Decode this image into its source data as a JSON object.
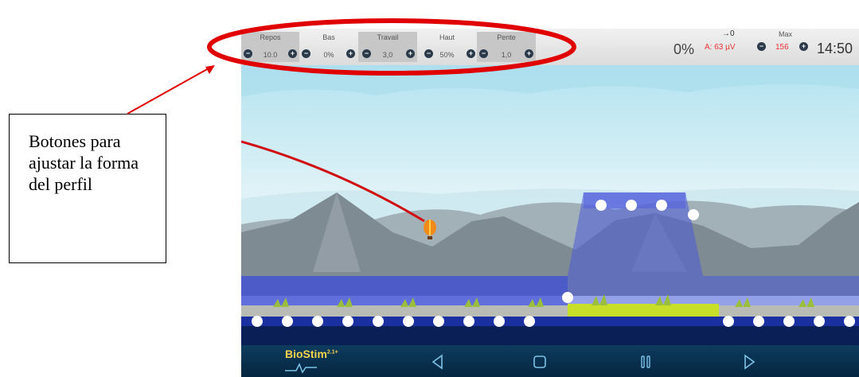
{
  "controls": [
    {
      "label": "Repos",
      "value": "10.0"
    },
    {
      "label": "Bas",
      "value": "0%"
    },
    {
      "label": "Travail",
      "value": "3,0"
    },
    {
      "label": "Haut",
      "value": "50%"
    },
    {
      "label": "Pente",
      "value": "1,0"
    }
  ],
  "status": {
    "percent": "0%",
    "arrow_label": "→0",
    "amplitude": "A: 63 µV",
    "max_label": "Max",
    "max_value": "156",
    "clock": "14:50"
  },
  "navbar": {
    "brand_main": "BioStim",
    "brand_super": "2.1+"
  },
  "callout": {
    "text": "Botones para ajustar la forma del perfil"
  },
  "colors": {
    "highlight_ellipse": "#e00000",
    "trace_line": "#d01010",
    "profile_band": "#4b5ad8",
    "grass": "#c8df2a",
    "navbar": "#0b3556"
  }
}
